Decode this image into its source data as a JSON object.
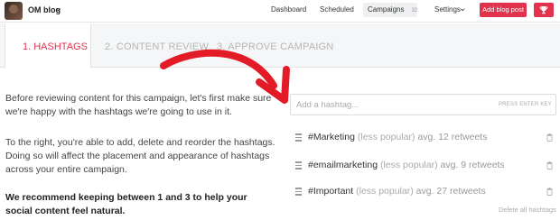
{
  "header": {
    "blog_name": "OM blog",
    "nav": {
      "dashboard": "Dashboard",
      "scheduled": "Scheduled",
      "campaigns": "Campaigns",
      "campaigns_count": "32",
      "settings": "Settings"
    },
    "add_blog_post": "Add blog post",
    "accent_color": "#e3324d"
  },
  "tabs": [
    {
      "label": "1. HASHTAGS",
      "active": true
    },
    {
      "label": "2. CONTENT REVIEW",
      "active": false
    },
    {
      "label": "3. APPROVE CAMPAIGN",
      "active": false
    }
  ],
  "intro": {
    "p1": "Before reviewing content for this campaign, let's first make sure we're happy with the hashtags we're going to use in it.",
    "p2": "To the right, you're able to add, delete and reorder the hashtags. Doing so will affect the placement and appearance of hashtags across your entire campaign.",
    "p3": "We recommend keeping between 1 and 3 to help your social content feel natural."
  },
  "hashtag_input": {
    "placeholder": "Add a hashtag...",
    "value": "",
    "hint": "PRESS ENTER KEY"
  },
  "hashtags": [
    {
      "name": "#Marketing",
      "popularity": "(less popular)",
      "avg": "avg. 12 retweets"
    },
    {
      "name": "#emailmarketing",
      "popularity": "(less popular)",
      "avg": "avg. 9 retweets"
    },
    {
      "name": "#Important",
      "popularity": "(less popular)",
      "avg": "avg. 27 retweets"
    }
  ],
  "delete_all": "Delete all hashtags",
  "icons": {
    "caret": "chevron-down-icon",
    "trophy": "trophy-icon",
    "drag": "drag-handle-icon",
    "trash": "trash-icon",
    "arrow": "curved-arrow-icon"
  }
}
